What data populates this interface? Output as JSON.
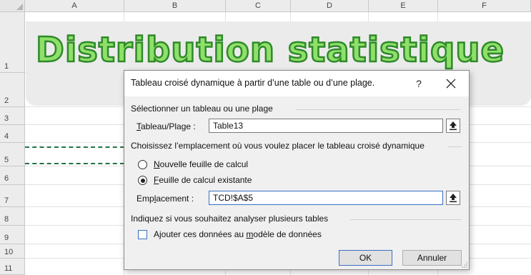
{
  "sheet": {
    "columns": [
      "A",
      "B",
      "C",
      "D",
      "E",
      "F"
    ],
    "rows": [
      "1",
      "2",
      "3",
      "4",
      "5",
      "6",
      "7",
      "8",
      "9",
      "10",
      "11"
    ],
    "title": "Distribution statistique",
    "title_fill": "#8fe06a",
    "title_stroke": "#2f8a2a",
    "marquee_color": "#217346"
  },
  "dialog": {
    "title": "Tableau croisé dynamique à partir d’une table ou d’une plage.",
    "help": "?",
    "section1": "Sélectionner un tableau ou une plage",
    "range_label_ul": "T",
    "range_label_rest": "ableau/Plage :",
    "range_value": "Table13",
    "section2": "Choisissez l’emplacement où vous voulez placer le tableau croisé dynamique",
    "opt_new_ul": "N",
    "opt_new_rest": "ouvelle feuille de calcul",
    "opt_existing_ul": "F",
    "opt_existing_rest": "euille de calcul existante",
    "selected_option": "existing",
    "location_label_pre": "Emp",
    "location_label_ul": "l",
    "location_label_post": "acement :",
    "location_value": "TCD!$A$5",
    "section3": "Indiquez si vous souhaitez analyser plusieurs tables",
    "datamodel_pre": "Ajouter ces données au ",
    "datamodel_ul": "m",
    "datamodel_post": "odèle de données",
    "datamodel_checked": false,
    "ok": "OK",
    "cancel": "Annuler",
    "accent": "#3a6fc4"
  }
}
